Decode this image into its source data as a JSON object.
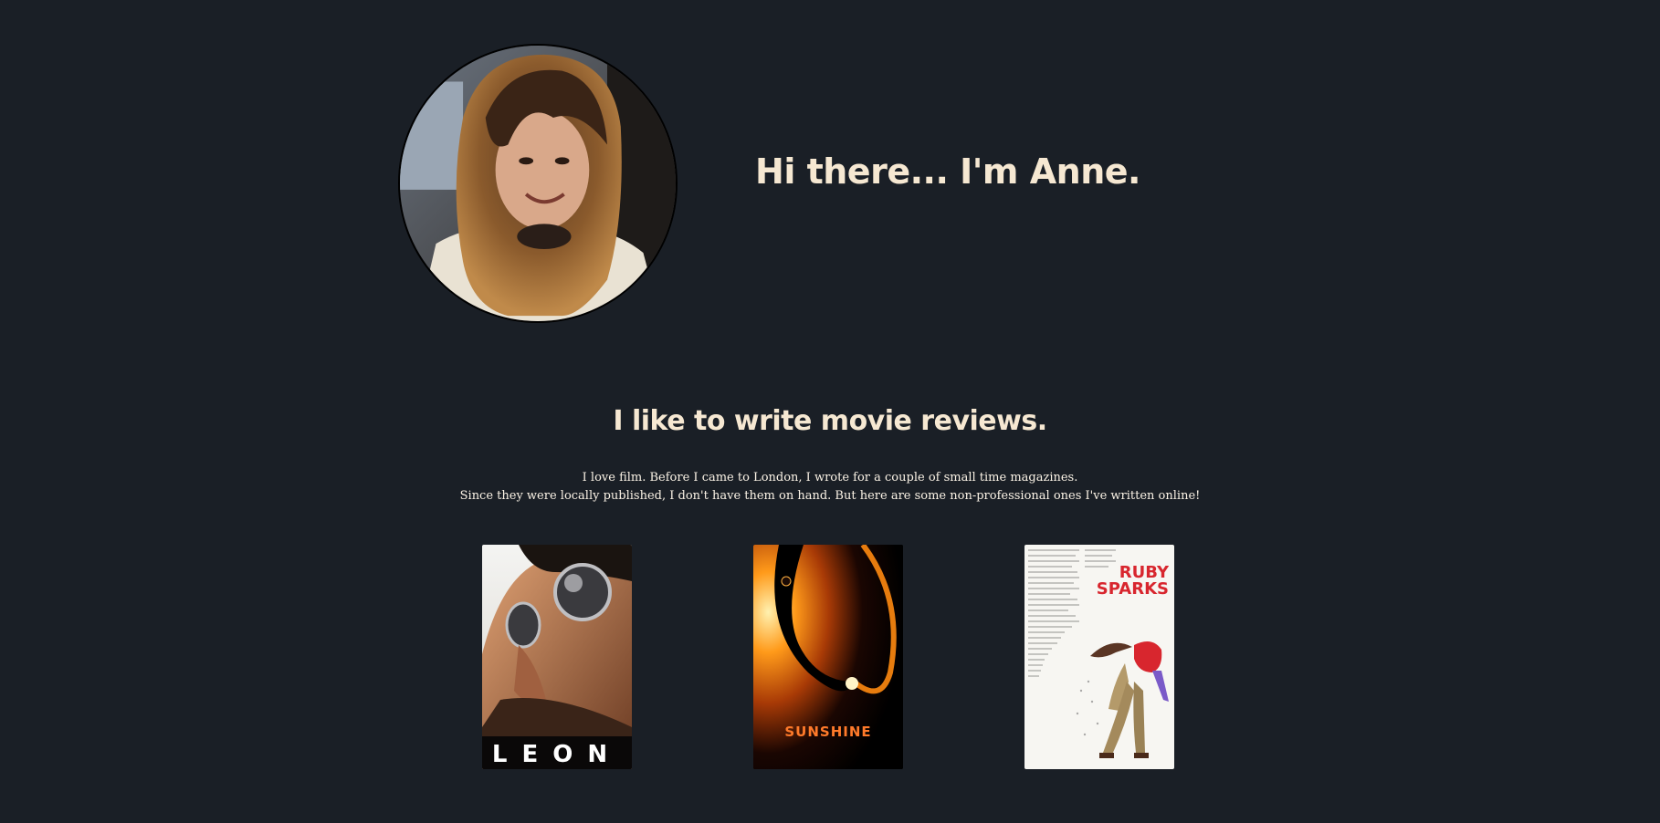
{
  "hero": {
    "greeting": "Hi there... I'm Anne."
  },
  "reviews": {
    "heading": "I like to write movie reviews.",
    "intro_lines": [
      "I love film. Before I came to London, I wrote for a couple of small time magazines.",
      "Since they were locally published, I don't have them on hand. But here are some non-professional ones I've written online!"
    ],
    "posters": [
      {
        "title": "LEON"
      },
      {
        "title": "SUNSHINE"
      },
      {
        "title_line1": "RUBY",
        "title_line2": "SPARKS"
      }
    ]
  },
  "colors": {
    "background": "#1a1f26",
    "text": "#f6e8d2",
    "ruby_red": "#d8262e"
  }
}
